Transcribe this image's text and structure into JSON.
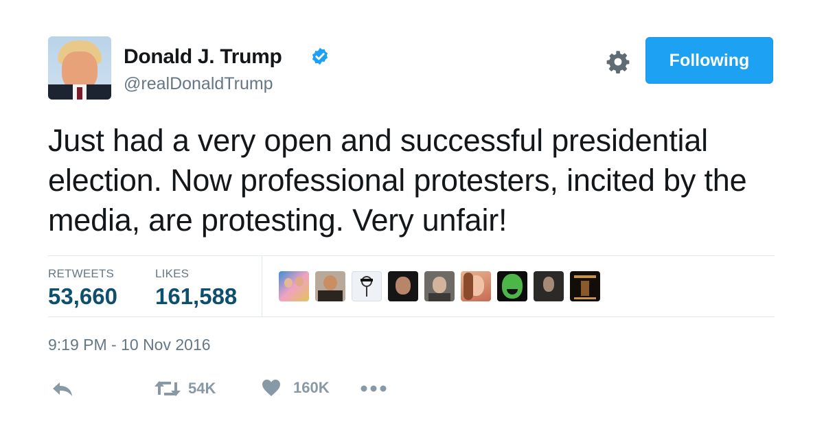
{
  "user": {
    "name": "Donald J. Trump",
    "handle": "@realDonaldTrump",
    "verified": true,
    "follow_button_label": "Following"
  },
  "tweet": {
    "text": "Just had a very open and successful presidential election. Now professional protesters, incited by the media, are protesting. Very unfair!",
    "timestamp": "9:19 PM - 10 Nov 2016"
  },
  "stats": {
    "retweets_label": "RETWEETS",
    "retweets_value": "53,660",
    "likes_label": "LIKES",
    "likes_value": "161,588"
  },
  "likers": [
    {
      "icon": "liker-avatar-1"
    },
    {
      "icon": "liker-avatar-2"
    },
    {
      "icon": "liker-avatar-3"
    },
    {
      "icon": "liker-avatar-4"
    },
    {
      "icon": "liker-avatar-5"
    },
    {
      "icon": "liker-avatar-6"
    },
    {
      "icon": "liker-avatar-7"
    },
    {
      "icon": "liker-avatar-8"
    },
    {
      "icon": "liker-avatar-9"
    }
  ],
  "actions": {
    "reply_icon": "reply-icon",
    "retweet_icon": "retweet-icon",
    "retweet_count": "54K",
    "like_icon": "heart-icon",
    "like_count": "160K",
    "more_icon": "more-icon"
  },
  "colors": {
    "accent": "#1da1f2",
    "stat_value": "#0f4f6e",
    "secondary_text": "#657786",
    "action_grey": "#8899a6"
  }
}
